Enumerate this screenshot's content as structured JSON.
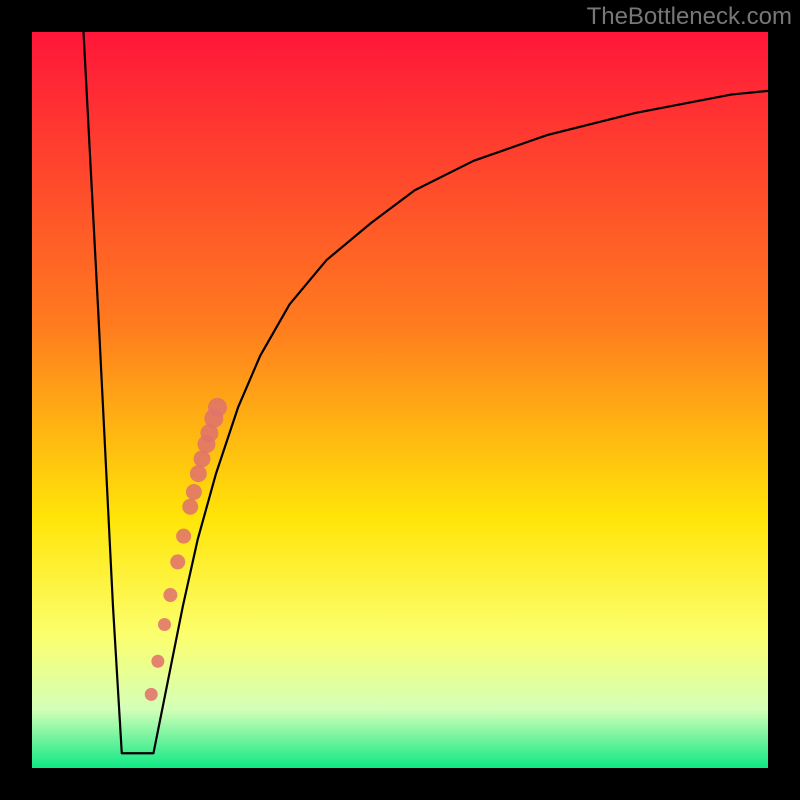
{
  "watermark": "TheBottleneck.com",
  "chart_data": {
    "type": "line",
    "title": "",
    "xlabel": "",
    "ylabel": "",
    "xlim": [
      0,
      100
    ],
    "ylim": [
      0,
      100
    ],
    "grid": false,
    "legend": false,
    "series": [
      {
        "name": "curve",
        "x": [
          7,
          9,
          11,
          12.2,
          13.5,
          15,
          16.5,
          18.5,
          20.5,
          22.5,
          25,
          28,
          31,
          35,
          40,
          46,
          52,
          60,
          70,
          82,
          95,
          100
        ],
        "y": [
          100,
          62,
          22,
          2,
          2,
          2,
          2,
          12,
          22,
          31,
          40,
          49,
          56,
          63,
          69,
          74,
          78.5,
          82.5,
          86,
          89,
          91.5,
          92
        ]
      }
    ],
    "markers": {
      "name": "highlight-points",
      "x": [
        16.2,
        17.1,
        18.0,
        18.8,
        19.8,
        20.6,
        21.5,
        22.0,
        22.6,
        23.1,
        23.7,
        24.1,
        24.7,
        25.2
      ],
      "y": [
        10,
        14.5,
        19.5,
        23.5,
        28,
        31.5,
        35.5,
        37.5,
        40,
        42,
        44,
        45.5,
        47.5,
        49
      ],
      "r": [
        6.5,
        6.5,
        6.5,
        7.0,
        7.5,
        7.5,
        8.0,
        8.0,
        8.5,
        8.5,
        9.0,
        9.0,
        9.5,
        9.5
      ],
      "color": "#e0736b"
    },
    "background_gradient": {
      "top_color": "#ff163a",
      "mid_upper_color": "#ff7c1e",
      "mid_color": "#ffe508",
      "mid_lower_color": "#fcff6e",
      "near_bottom_color": "#d4ffb8",
      "bottom_color": "#0fe884"
    },
    "frame": {
      "outer_size": 800,
      "inner_margin": 32
    }
  }
}
